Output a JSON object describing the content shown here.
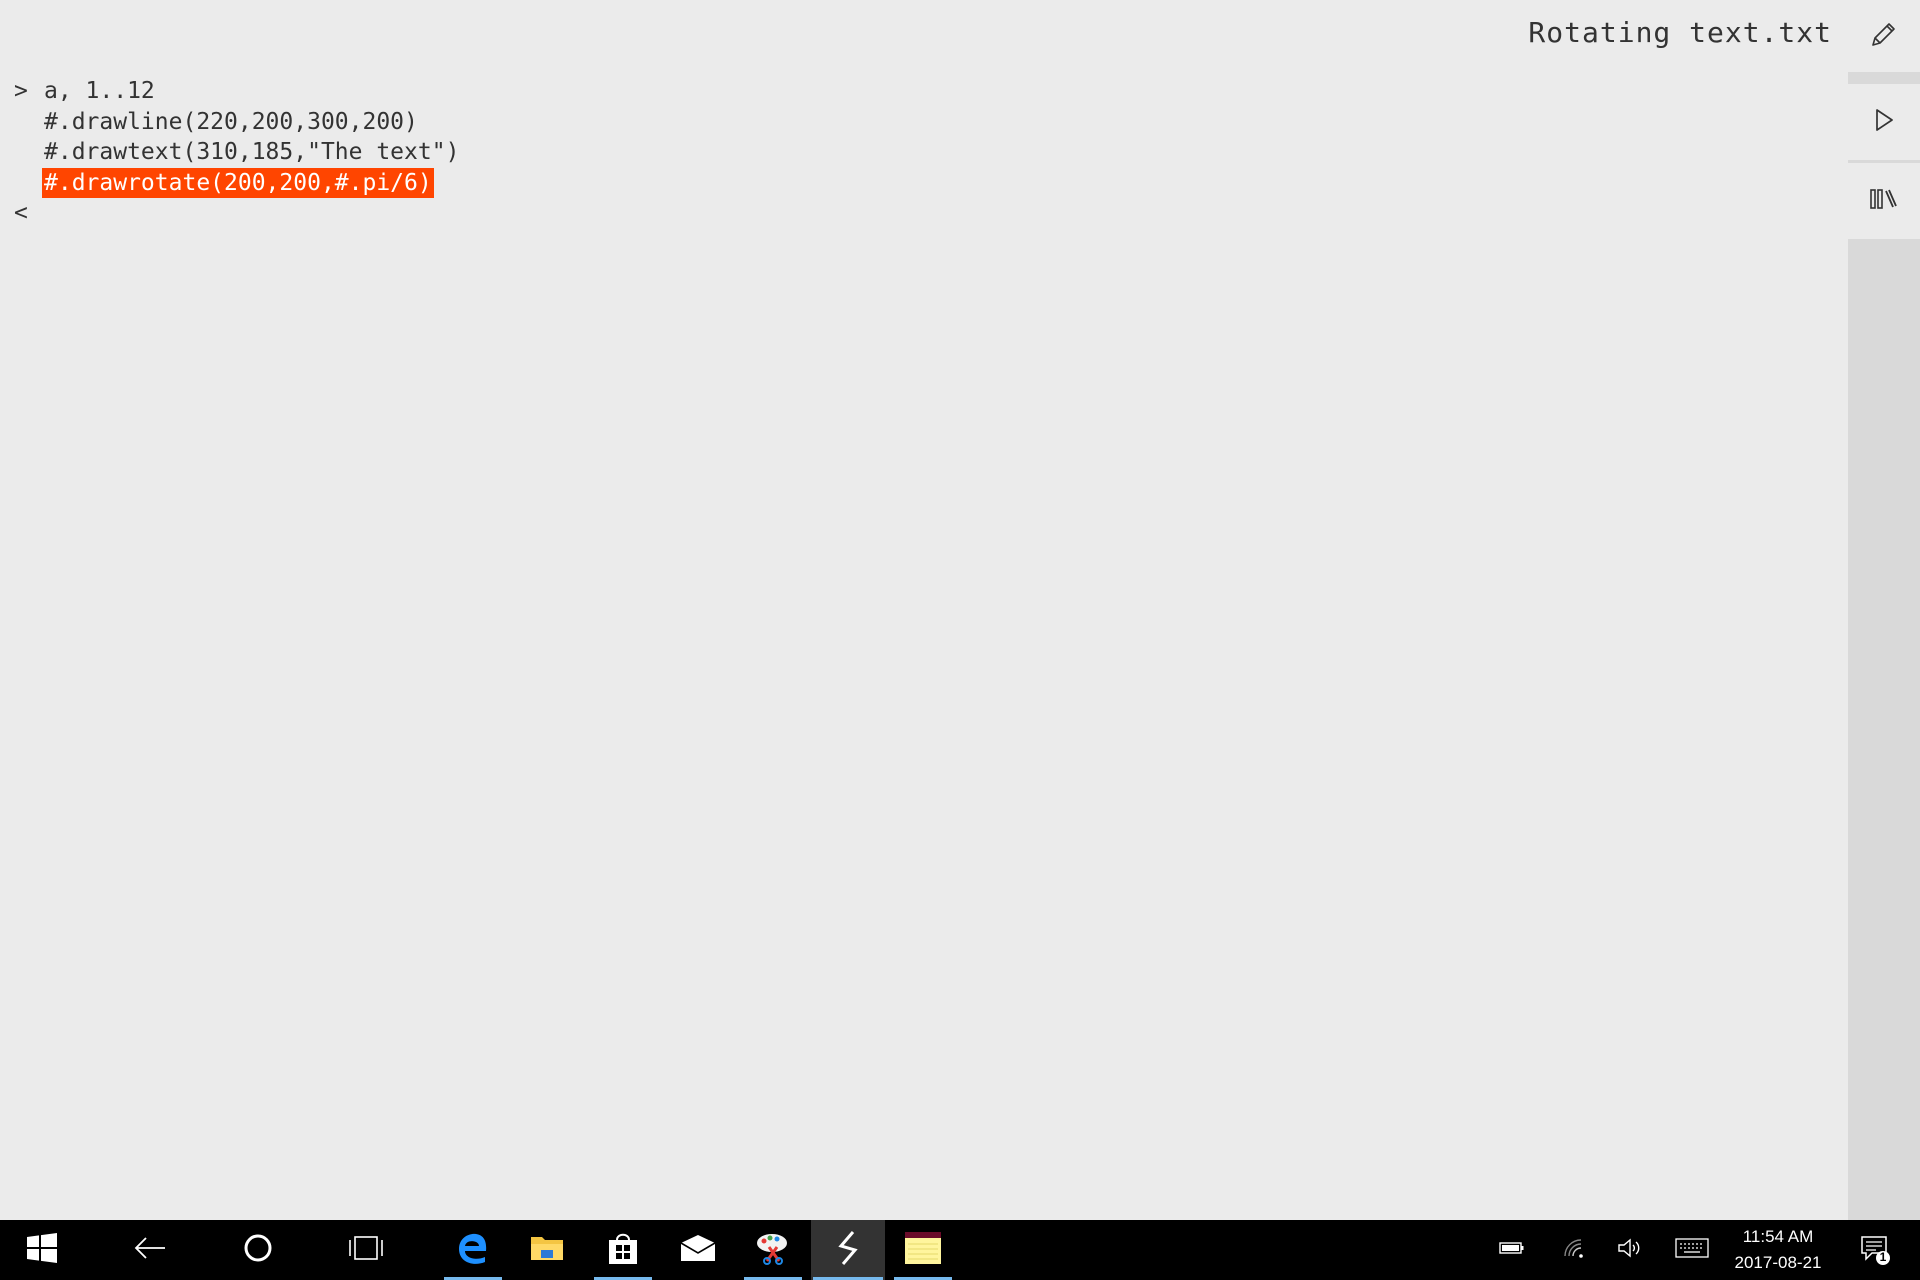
{
  "document": {
    "title": "Rotating text.txt"
  },
  "editor": {
    "lines": [
      {
        "prompt": ">",
        "text": "a, 1..12",
        "selected": false
      },
      {
        "prompt": "",
        "text": "#.drawline(220,200,300,200)",
        "selected": false
      },
      {
        "prompt": "",
        "text": "#.drawtext(310,185,\"The text\")",
        "selected": false
      },
      {
        "prompt": "",
        "text": "#.drawrotate(200,200,#.pi/6)",
        "selected": true
      },
      {
        "prompt": "<",
        "text": "",
        "selected": false
      }
    ],
    "selection_color": "#ff4500"
  },
  "toolbar": {
    "edit_icon": "pencil-icon",
    "run_icon": "play-icon",
    "library_icon": "library-icon"
  },
  "taskbar": {
    "buttons": [
      {
        "name": "start-button",
        "icon": "windows-logo-icon"
      },
      {
        "name": "back-button",
        "icon": "back-arrow-icon"
      },
      {
        "name": "cortana-button",
        "icon": "circle-icon"
      },
      {
        "name": "task-view-button",
        "icon": "task-view-icon"
      }
    ],
    "apps": [
      {
        "name": "edge",
        "icon": "edge-icon",
        "running": true,
        "active": false
      },
      {
        "name": "file-explorer",
        "icon": "folder-icon",
        "running": false,
        "active": false
      },
      {
        "name": "store",
        "icon": "store-bag-icon",
        "running": true,
        "active": false
      },
      {
        "name": "mail",
        "icon": "mail-icon",
        "running": false,
        "active": false
      },
      {
        "name": "paint",
        "icon": "palette-icon",
        "running": true,
        "active": false
      },
      {
        "name": "code-app",
        "icon": "lightning-icon",
        "running": true,
        "active": true
      },
      {
        "name": "sticky-notes",
        "icon": "notes-icon",
        "running": true,
        "active": false
      }
    ],
    "tray": {
      "battery_icon": "battery-icon",
      "wifi_icon": "wifi-icon",
      "volume_icon": "volume-icon",
      "keyboard_icon": "keyboard-icon",
      "time": "11:54 AM",
      "date": "2017-08-21",
      "notification_count": "1"
    }
  }
}
